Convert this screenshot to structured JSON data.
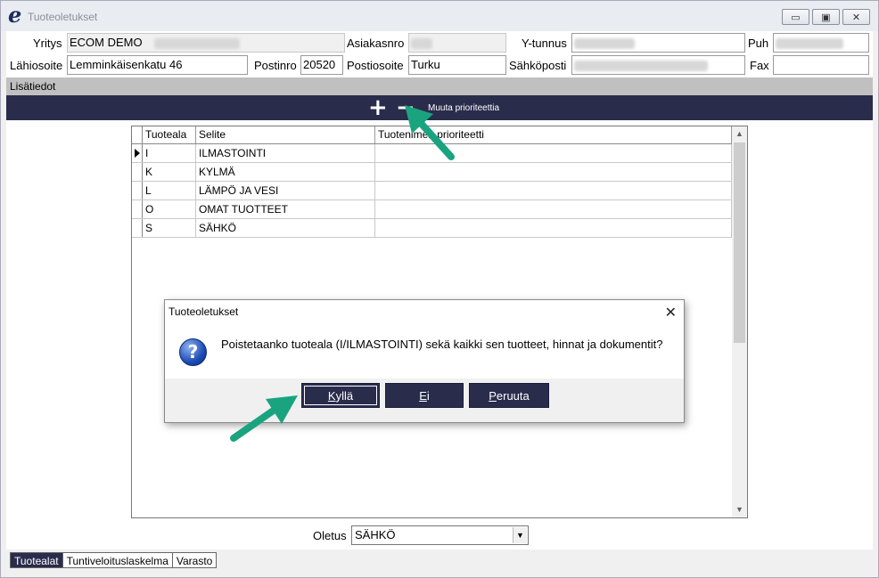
{
  "window": {
    "title": "Tuoteoletukset",
    "app_icon": "e-logo-icon",
    "controls": {
      "minimize": "▭",
      "maximize": "▣",
      "close": "✕"
    }
  },
  "form": {
    "yritys_label": "Yritys",
    "yritys_value": "ECOM DEMO",
    "asiakasnro_label": "Asiakasnro",
    "ytunnus_label": "Y-tunnus",
    "puh_label": "Puh",
    "lahiosoite_label": "Lähiosoite",
    "lahiosoite_value": "Lemminkäisenkatu 46",
    "postinro_label": "Postinro",
    "postinro_value": "20520",
    "postiosoite_label": "Postiosoite",
    "postiosoite_value": "Turku",
    "sahkoposti_label": "Sähköposti",
    "fax_label": "Fax"
  },
  "extra_bar": {
    "label": "Lisätiedot"
  },
  "toolbar": {
    "add": "+",
    "remove": "−",
    "priority_label": "Muuta prioriteettia"
  },
  "grid": {
    "headers": [
      "Tuoteala",
      "Selite",
      "Tuotenimen prioriteetti"
    ],
    "rows": [
      {
        "code": "I",
        "desc": "ILMASTOINTI",
        "prio": ""
      },
      {
        "code": "K",
        "desc": "KYLMÄ",
        "prio": ""
      },
      {
        "code": "L",
        "desc": "LÄMPÖ JA VESI",
        "prio": ""
      },
      {
        "code": "O",
        "desc": "OMAT TUOTTEET",
        "prio": ""
      },
      {
        "code": "S",
        "desc": "SÄHKÖ",
        "prio": ""
      }
    ]
  },
  "dialog": {
    "title": "Tuoteoletukset",
    "message": "Poistetaanko tuoteala (I/ILMASTOINTI) sekä kaikki sen tuotteet, hinnat ja dokumentit?",
    "yes_first": "K",
    "yes_rest": "yllä",
    "no_first": "E",
    "no_rest": "i",
    "cancel_first": "P",
    "cancel_rest": "eruuta"
  },
  "oletus": {
    "label": "Oletus",
    "value": "SÄHKÖ"
  },
  "tabs": [
    {
      "label": "Tuotealat",
      "active": true
    },
    {
      "label": "Tuntiveloituslaskelma",
      "active": false
    },
    {
      "label": "Varasto",
      "active": false
    }
  ],
  "colors": {
    "accent": "#2a2c4c",
    "annotation_arrow": "#1aa37f"
  }
}
